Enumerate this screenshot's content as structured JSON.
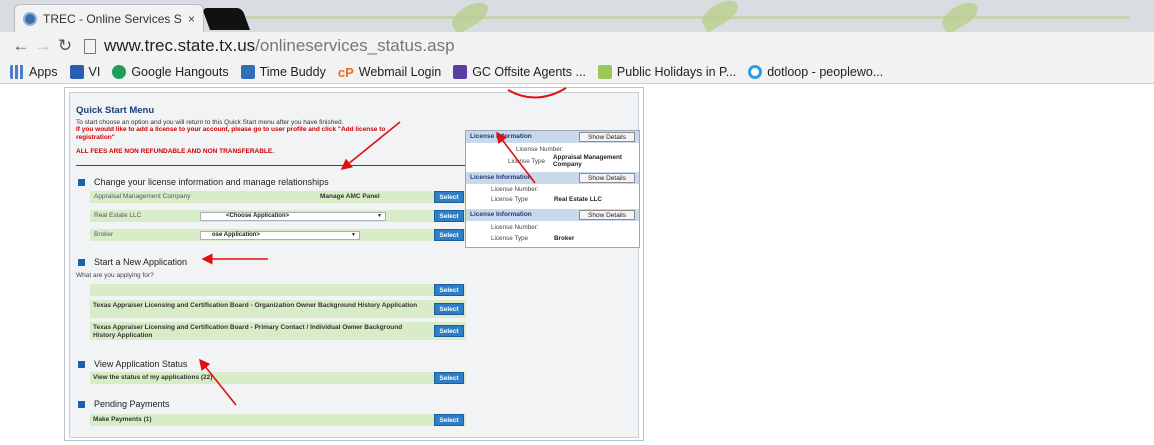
{
  "browser": {
    "tab_title": "TREC - Online Services Sta",
    "tab_close": "×",
    "url_host": "www.trec.state.tx.us",
    "url_path": "/onlineservices_status.asp",
    "bookmarks": [
      {
        "label": "Apps",
        "icon": "apps-grid-icon"
      },
      {
        "label": "VI",
        "icon": "vi-icon"
      },
      {
        "label": "Google Hangouts",
        "icon": "hangouts-icon"
      },
      {
        "label": "Time Buddy",
        "icon": "time-buddy-icon"
      },
      {
        "label": "Webmail Login",
        "icon": "cpanel-icon"
      },
      {
        "label": "GC Offsite Agents ...",
        "icon": "gc-icon"
      },
      {
        "label": "Public Holidays in P...",
        "icon": "holiday-icon"
      },
      {
        "label": "dotloop - peoplewo...",
        "icon": "dotloop-icon"
      }
    ]
  },
  "quick_start": {
    "title": "Quick Start Menu",
    "intro": "To start choose an option and you will return to this Quick Start menu after you have finished.",
    "red_note": "If you would like to add a license to your account, please go to user profile and click \"Add license to registration\"",
    "fees": "ALL FEES ARE NON REFUNDABLE AND NON TRANSFERABLE."
  },
  "sections": {
    "change": {
      "heading": "Change your license information and manage relationships",
      "rows": [
        {
          "left": "Appraisal Management Company",
          "mid": "Manage AMC Panel",
          "button": "Select"
        },
        {
          "left": "Real Estate LLC",
          "select": "<Choose Application>",
          "button": "Select"
        },
        {
          "left": "Broker",
          "select": "ose Application>",
          "button": "Select"
        }
      ]
    },
    "new_app": {
      "heading": "Start a New Application",
      "sub": "What are you applying for?",
      "rows": [
        {
          "text": "",
          "button": "Select"
        },
        {
          "text": "Texas Appraiser Licensing and Certification Board - Organization Owner Background History Application",
          "button": "Select"
        },
        {
          "text": "Texas Appraiser Licensing and Certification Board - Primary Contact / Individual Owner Background History Application",
          "button": "Select"
        }
      ]
    },
    "status": {
      "heading": "View Application Status",
      "row": {
        "text": "View the status of my applications (22)",
        "button": "Select"
      }
    },
    "payments": {
      "heading": "Pending Payments",
      "row": {
        "text": "Make Payments (1)",
        "button": "Select"
      }
    }
  },
  "license_panel": [
    {
      "header": "License Information",
      "button": "Show Details",
      "number_label": "License Number:",
      "type_label": "License Type",
      "type_value": "Appraisal Management Company"
    },
    {
      "header": "License Information",
      "button": "Show Details",
      "number_label": "License Number:",
      "type_label": "License Type",
      "type_value": "Real Estate LLC"
    },
    {
      "header": "License Information",
      "button": "Show Details",
      "number_label": "License Number:",
      "type_label": "License Type",
      "type_value": "Broker"
    }
  ]
}
